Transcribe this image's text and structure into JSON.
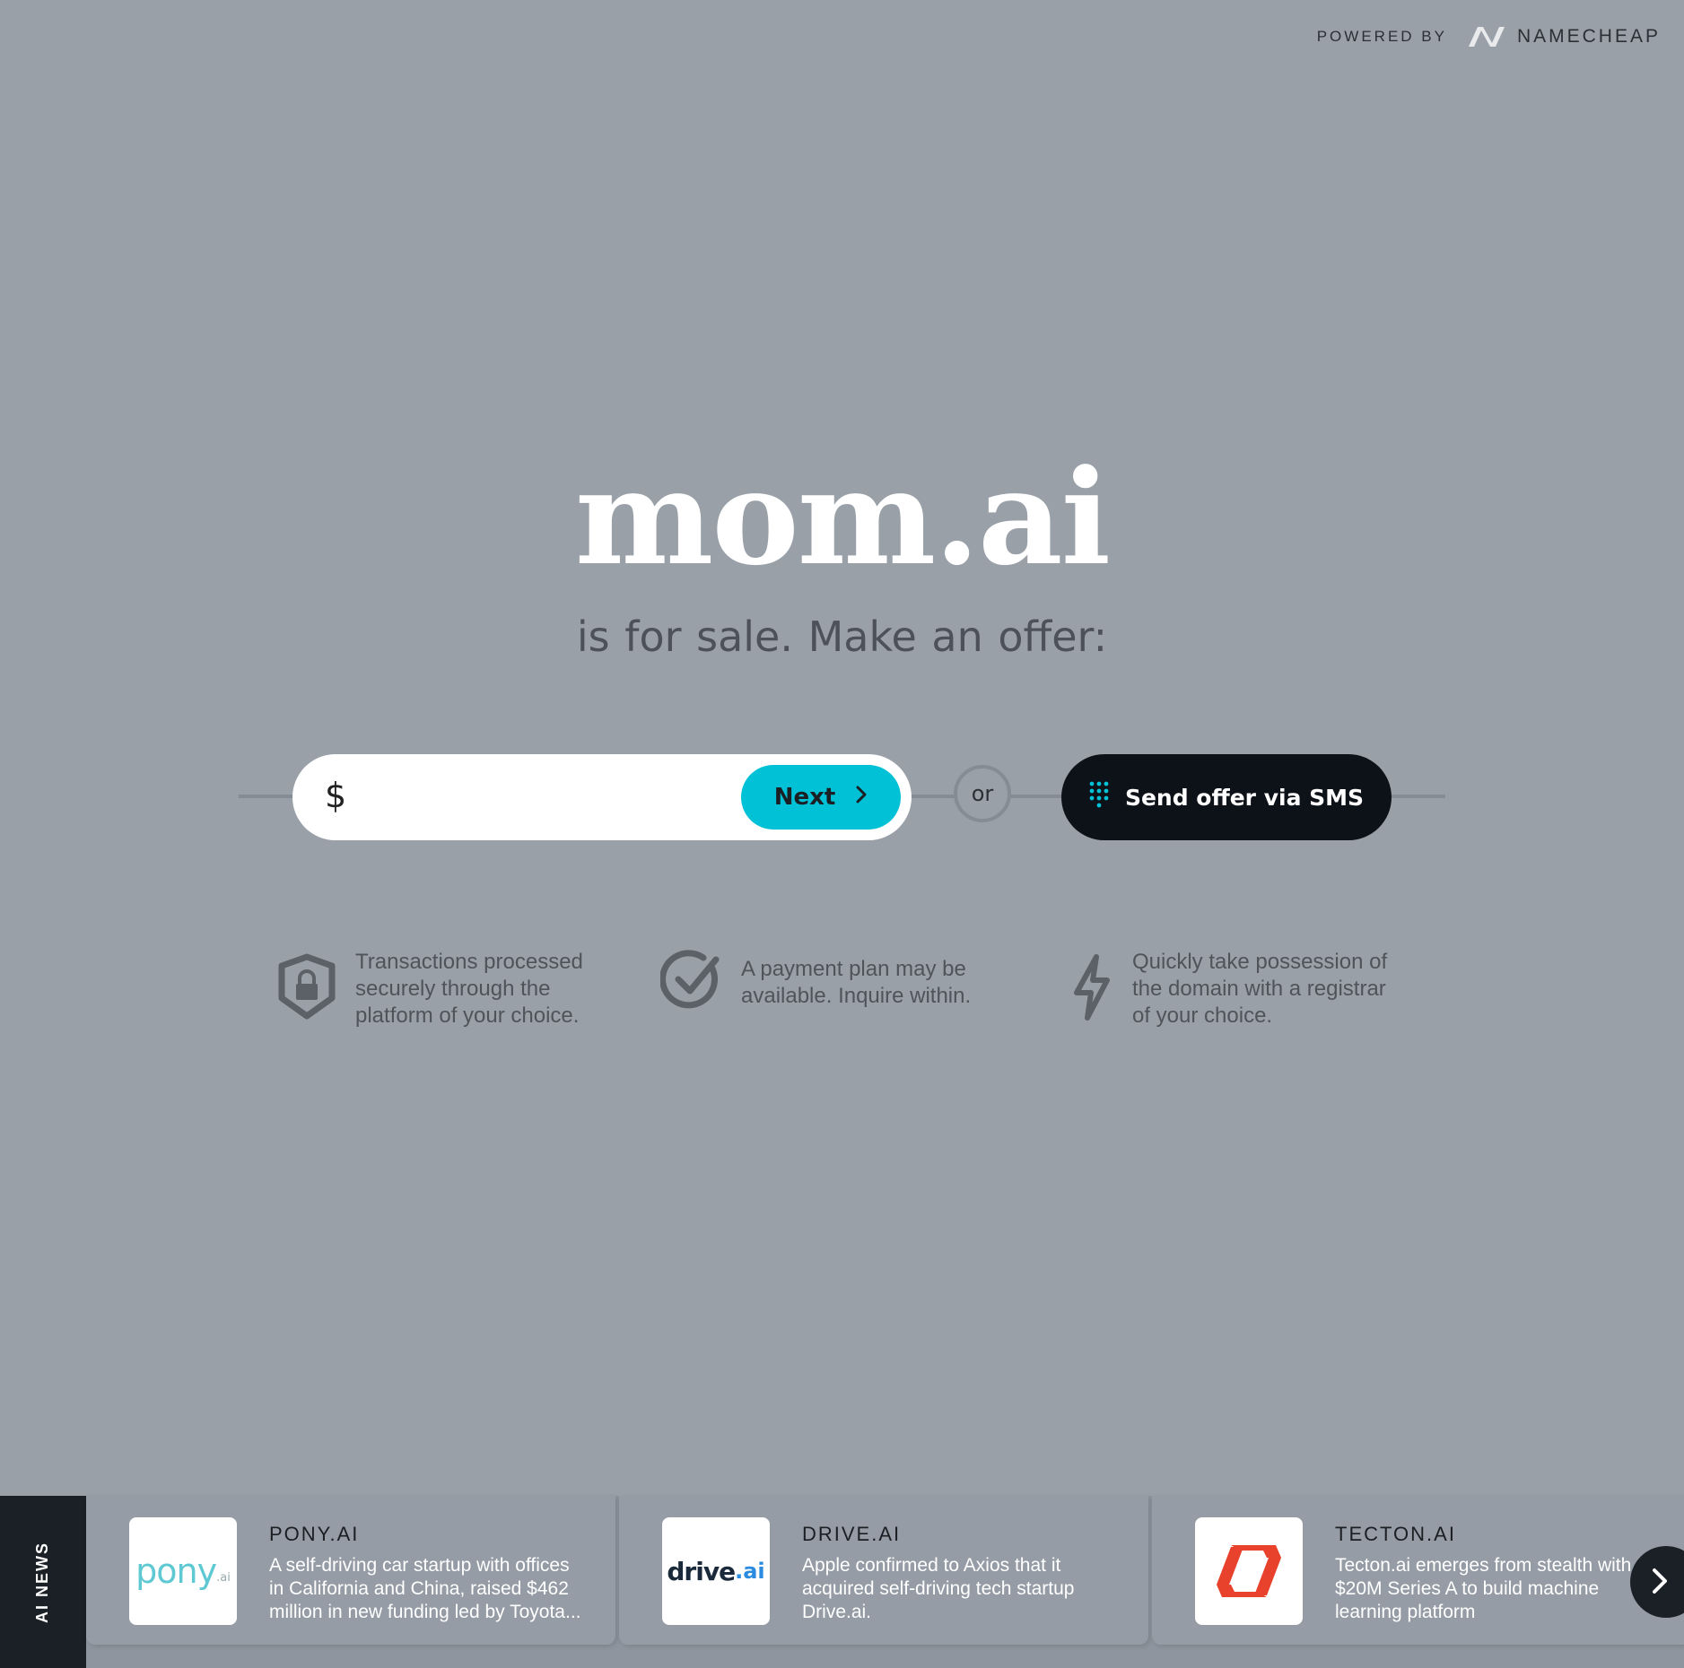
{
  "header": {
    "powered_by": "POWERED BY",
    "brand": "NAMECHEAP",
    "brand_icon": "namecheap-logo-icon"
  },
  "hero": {
    "domain": "mom.ai",
    "tagline": "is for sale.  Make an offer:"
  },
  "offer": {
    "currency_symbol": "$",
    "amount_value": "",
    "next_label": "Next",
    "or_label": "or",
    "sms_label": "Send offer via SMS",
    "sms_icon": "dialpad-icon",
    "accent_color": "#00c1d5",
    "sms_button_color": "#0d1218"
  },
  "features": [
    {
      "icon": "shield-lock-icon",
      "text_lines": [
        "Transactions processed",
        "securely through the",
        "platform of your choice."
      ]
    },
    {
      "icon": "check-circle-icon",
      "text_lines": [
        "A payment plan may be",
        "available. Inquire within."
      ]
    },
    {
      "icon": "lightning-icon",
      "text_lines": [
        "Quickly take possession of",
        "the domain with a registrar",
        "of your choice."
      ]
    }
  ],
  "news": {
    "label": "AI NEWS",
    "items": [
      {
        "title": "PONY.AI",
        "logo_text": "pony",
        "logo_suffix": ".ai",
        "desc_lines": [
          "A self-driving car startup with offices",
          "in California and China, raised $462",
          "million in new funding led by Toyota..."
        ]
      },
      {
        "title": "DRIVE.AI",
        "logo_text": "drive",
        "logo_suffix": ".ai",
        "desc_lines": [
          "Apple confirmed to Axios that it",
          "acquired self-driving tech startup",
          "Drive.ai."
        ]
      },
      {
        "title": "TECTON.AI",
        "logo_text": "",
        "logo_suffix": "",
        "desc_lines": [
          "Tecton.ai emerges from stealth with",
          "$20M Series A to build machine",
          "learning platform"
        ]
      }
    ],
    "next_icon": "chevron-right-icon"
  }
}
